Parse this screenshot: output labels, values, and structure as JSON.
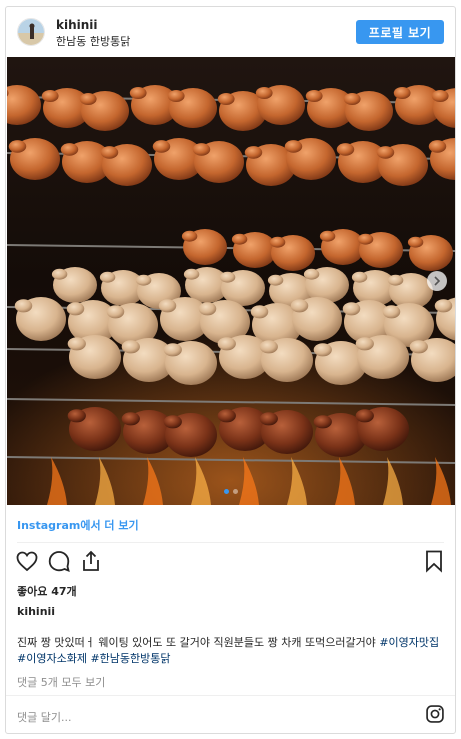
{
  "header": {
    "username": "kihinii",
    "location": "한남동 한방통닭",
    "profile_button": "프로필 보기"
  },
  "carousel": {
    "slide_count": 2,
    "active_index": 1
  },
  "view_more": "Instagram에서 더 보기",
  "likes": "좋아요 47개",
  "post": {
    "author": "kihinii",
    "caption_text": "진짜 짱 맛있떠ㅓ 웨이팅 있어도 또 갈거야 직원분들도 짱 차캐 또먹으러갈거야 ",
    "hashtags": [
      "#이영자맛집",
      "#이영자소화제",
      "#한남동한방통닭"
    ]
  },
  "comments_link": "댓글 5개 모두 보기",
  "comment_placeholder": "댓글 달기...",
  "icons": [
    "heart-icon",
    "comment-icon",
    "share-icon",
    "bookmark-icon",
    "instagram-icon",
    "chevron-right-icon"
  ],
  "colors": {
    "accent": "#3897f0",
    "hashtag": "#003569",
    "muted": "#8e8e8e"
  }
}
